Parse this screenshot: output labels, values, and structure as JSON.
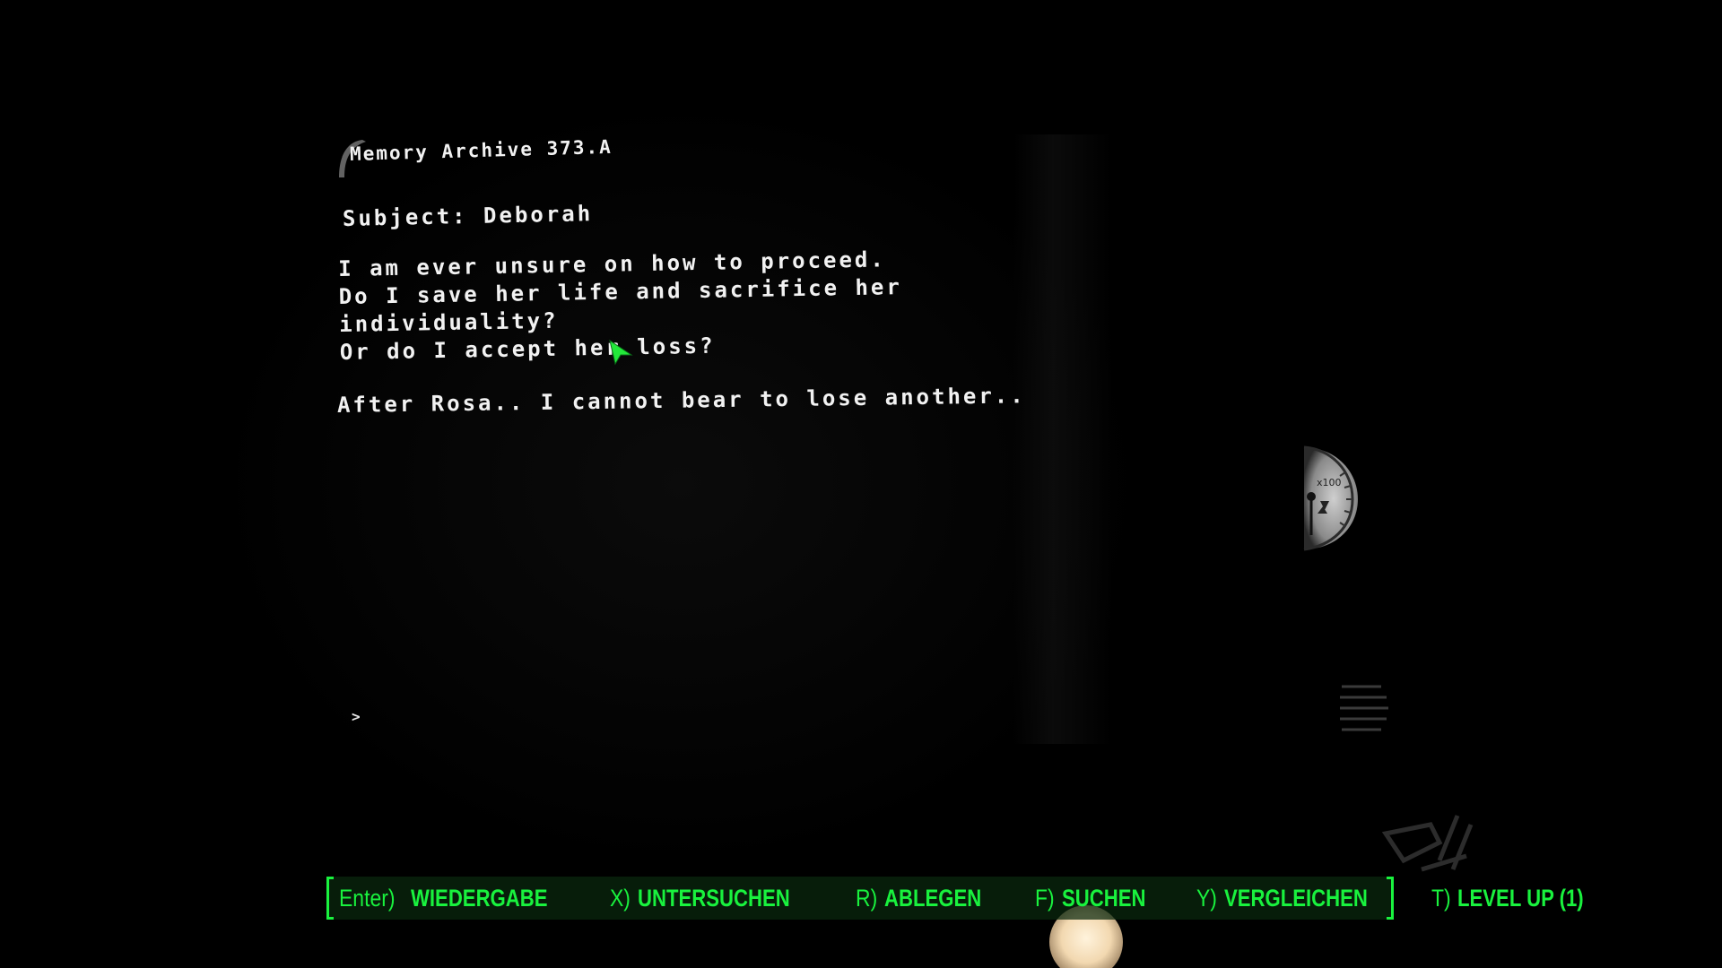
{
  "terminal": {
    "title": "Memory Archive 373.A",
    "subject": "Subject: Deborah",
    "lines": [
      "I am ever unsure on how to proceed.",
      "Do I save her life and sacrifice her",
      "individuality?",
      "Or do I accept her loss?"
    ],
    "closing": "After Rosa.. I cannot bear to lose another..",
    "prompt": ">"
  },
  "gauge": {
    "label": "x100"
  },
  "hint_bar": {
    "accent_color": "#19f23e",
    "items": [
      {
        "key": "Enter)",
        "label": "WIEDERGABE"
      },
      {
        "key": "X)",
        "label": "UNTERSUCHEN"
      },
      {
        "key": "R)",
        "label": "ABLEGEN"
      },
      {
        "key": "F)",
        "label": "SUCHEN"
      },
      {
        "key": "Y)",
        "label": "VERGLEICHEN"
      },
      {
        "key": "T)",
        "label": "LEVEL UP (1)"
      }
    ]
  },
  "icons": {
    "cursor": "cursor-arrow-icon",
    "gauge": "radiation-gauge-icon",
    "lamp": "lamp-glow-icon"
  }
}
